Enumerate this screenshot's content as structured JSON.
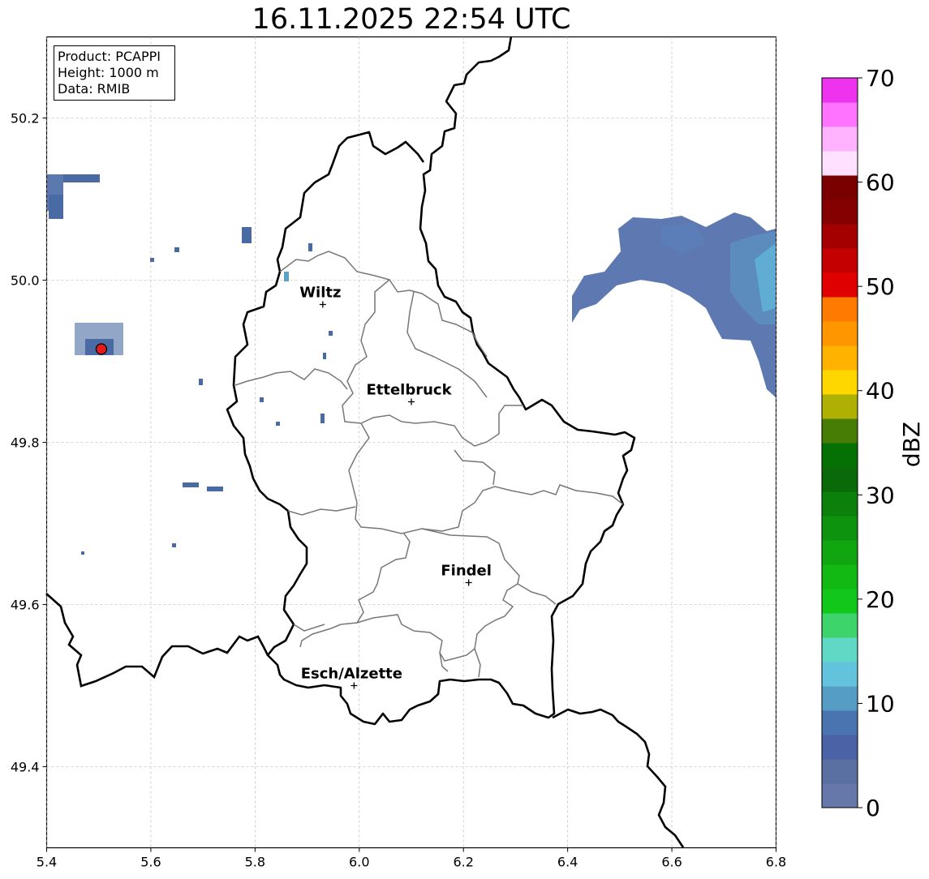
{
  "title": "16.11.2025 22:54 UTC",
  "info": {
    "product": "Product: PCAPPI",
    "height": "Height: 1000 m",
    "data": "Data: RMIB"
  },
  "map": {
    "lon_range": [
      5.4,
      6.8
    ],
    "lat_range": [
      49.3,
      50.3
    ],
    "x_ticks": [
      "5.4",
      "5.6",
      "5.8",
      "6.0",
      "6.2",
      "6.4",
      "6.6",
      "6.8"
    ],
    "y_ticks": [
      "49.4",
      "49.6",
      "49.8",
      "50.0",
      "50.2"
    ],
    "grid": true,
    "cities": [
      {
        "name": "Wiltz",
        "lon": 5.93,
        "lat": 49.97
      },
      {
        "name": "Ettelbruck",
        "lon": 6.1,
        "lat": 49.85
      },
      {
        "name": "Findel",
        "lon": 6.21,
        "lat": 49.627
      },
      {
        "name": "Esch/Alzette",
        "lon": 5.99,
        "lat": 49.5
      }
    ],
    "radar_site": {
      "lon": 5.505,
      "lat": 49.915,
      "color": "#e31a1c"
    }
  },
  "colorbar": {
    "label": "dBZ",
    "min": 0,
    "max": 70,
    "ticks": [
      "0",
      "10",
      "20",
      "30",
      "40",
      "50",
      "60",
      "70"
    ],
    "colors": [
      "#6677aa",
      "#5a6fa2",
      "#4b62a6",
      "#4a74b0",
      "#559dc5",
      "#63c3dd",
      "#5fd8c6",
      "#3dd46b",
      "#11c81a",
      "#12b912",
      "#0fa60f",
      "#0e930e",
      "#0b810b",
      "#0a6a0a",
      "#057105",
      "#487d05",
      "#aeb003",
      "#ffd700",
      "#ffb300",
      "#ff9600",
      "#ff7a00",
      "#e00000",
      "#c50000",
      "#a50000",
      "#850000",
      "#7a0000",
      "#ffe0ff",
      "#ffb3ff",
      "#ff73ff",
      "#ee33ee"
    ]
  }
}
